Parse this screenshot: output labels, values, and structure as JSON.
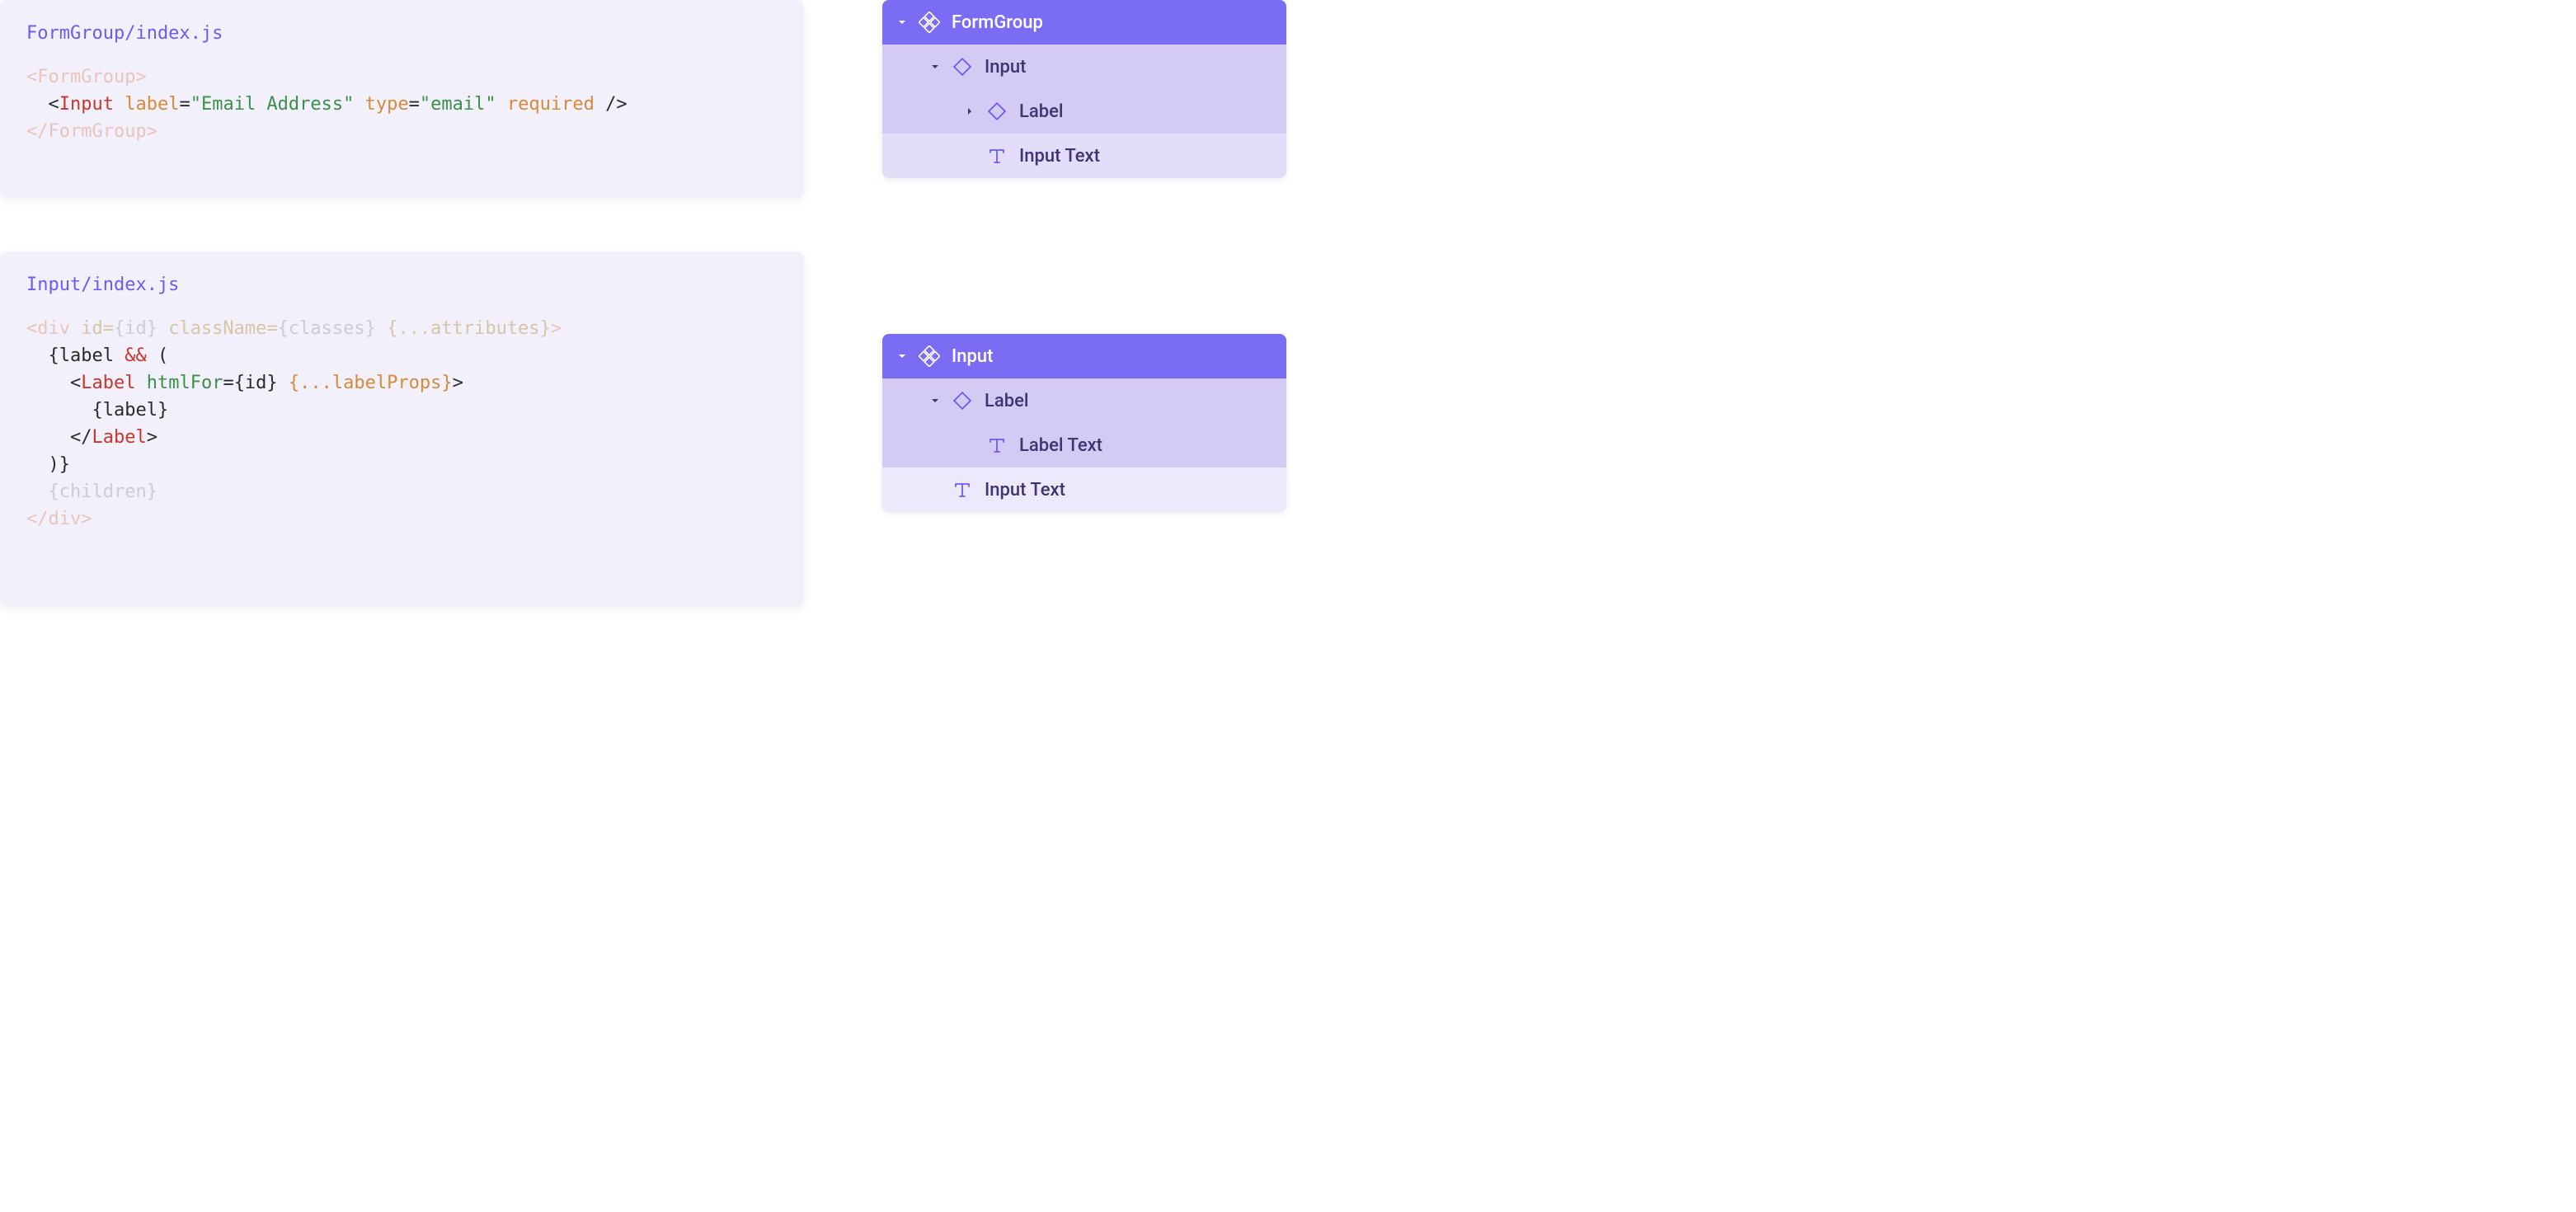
{
  "panel1": {
    "title": "FormGroup/index.js",
    "code": {
      "line1_open": "<FormGroup>",
      "line2_pre": "  <",
      "line2_tag": "Input",
      "line2_sp1": " ",
      "line2_attr1": "label",
      "line2_eq1": "=",
      "line2_str1": "\"Email Address\"",
      "line2_sp2": " ",
      "line2_attr2": "type",
      "line2_eq2": "=",
      "line2_str2": "\"email\"",
      "line2_sp3": " ",
      "line2_attr3": "required",
      "line2_close": " />",
      "line3_close": "</FormGroup>"
    }
  },
  "panel2": {
    "title": "Input/index.js",
    "code": {
      "l1_a": "<div",
      "l1_b": " id=",
      "l1_c": "{id}",
      "l1_d": " className=",
      "l1_e": "{classes}",
      "l1_f": " {...attributes}",
      "l1_g": ">",
      "l2_a": "  {label ",
      "l2_b": "&&",
      "l2_c": " (",
      "l3_a": "    <",
      "l3_b": "Label",
      "l3_c": " ",
      "l3_d": "htmlFor",
      "l3_e": "=",
      "l3_f": "{id}",
      "l3_g": " {...labelProps}",
      "l3_h": ">",
      "l4": "      {label}",
      "l5_a": "    </",
      "l5_b": "Label",
      "l5_c": ">",
      "l6": "  )}",
      "l7": "  {children}",
      "l8_a": "</",
      "l8_b": "div",
      "l8_c": ">"
    }
  },
  "tree1": {
    "header": "FormGroup",
    "rows": [
      {
        "label": "Input"
      },
      {
        "label": "Label"
      },
      {
        "label": "Input Text"
      }
    ]
  },
  "tree2": {
    "header": "Input",
    "rows": [
      {
        "label": "Label"
      },
      {
        "label": "Label Text"
      },
      {
        "label": "Input Text"
      }
    ]
  }
}
